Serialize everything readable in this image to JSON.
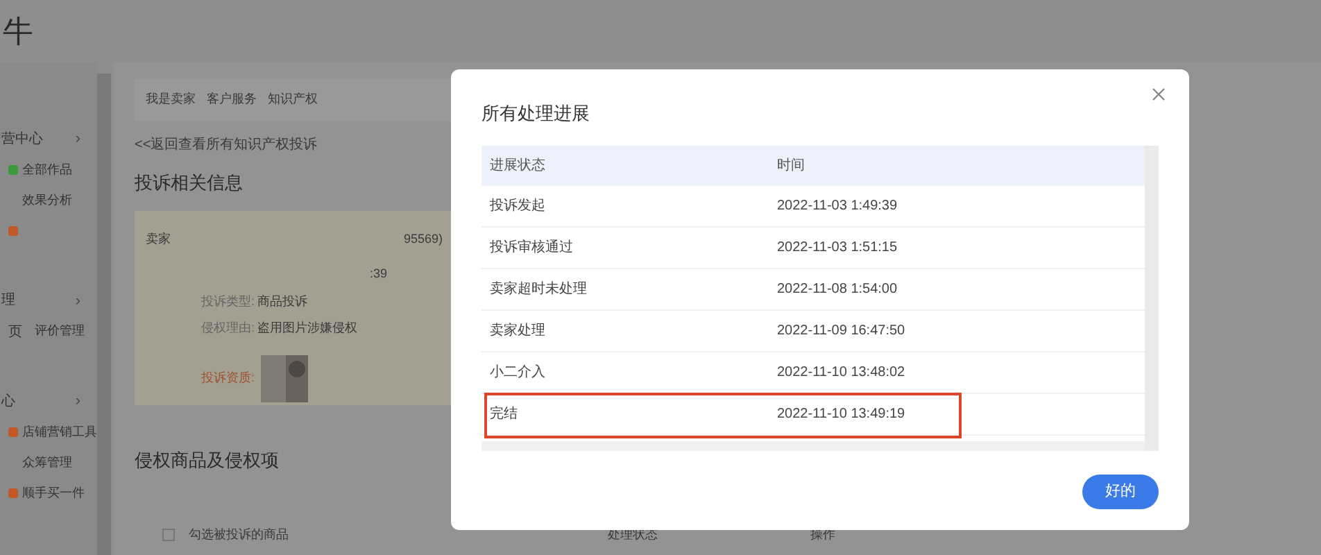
{
  "header": {
    "logo_text": "牛"
  },
  "sidebar": {
    "groups": [
      {
        "title": "营中心",
        "chevron": "›",
        "items": [
          {
            "label": "全部作品",
            "color": "#3c9a3c"
          },
          {
            "label": "效果分析"
          },
          {
            "color": "#c0582a"
          }
        ]
      },
      {
        "title": "理",
        "chevron": "›",
        "items": [
          {
            "label": "评价管理",
            "prefix": "页"
          }
        ]
      },
      {
        "title": "心",
        "chevron": "›",
        "items": [
          {
            "label": "店铺营销工具",
            "color": "#c0582a"
          },
          {
            "label": "众筹管理"
          },
          {
            "label": "顺手买一件",
            "color": "#c0582a"
          }
        ]
      }
    ]
  },
  "breadcrumb": [
    "我是卖家",
    "客户服务",
    "知识产权"
  ],
  "back_link": "<<返回查看所有知识产权投诉",
  "section_title": "投诉相关信息",
  "complaint_card": {
    "seller_label": "卖家",
    "seller_tail": "95569)",
    "time_tail": ":39",
    "fields": [
      {
        "label": "投诉类型:",
        "value": "商品投诉"
      },
      {
        "label": "侵权理由:",
        "value": "盗用图片涉嫌侵权"
      }
    ],
    "evidence_label": "投诉资质:"
  },
  "goods_section": {
    "title": "侵权商品及侵权项",
    "checkbox_checked": false,
    "checkbox_label": "勾选被投诉的商品",
    "columns": [
      "处理状态",
      "操作"
    ]
  },
  "dialog": {
    "title": "所有处理进展",
    "columns": [
      "进展状态",
      "时间"
    ],
    "rows": [
      {
        "status": "投诉发起",
        "time": "2022-11-03 1:49:39",
        "highlighted": false
      },
      {
        "status": "投诉审核通过",
        "time": "2022-11-03 1:51:15",
        "highlighted": false
      },
      {
        "status": "卖家超时未处理",
        "time": "2022-11-08 1:54:00",
        "highlighted": false
      },
      {
        "status": "卖家处理",
        "time": "2022-11-09 16:47:50",
        "highlighted": false
      },
      {
        "status": "小二介入",
        "time": "2022-11-10 13:48:02",
        "highlighted": false
      },
      {
        "status": "完结",
        "time": "2022-11-10 13:49:19",
        "highlighted": true
      }
    ],
    "ok_button": "好的"
  }
}
